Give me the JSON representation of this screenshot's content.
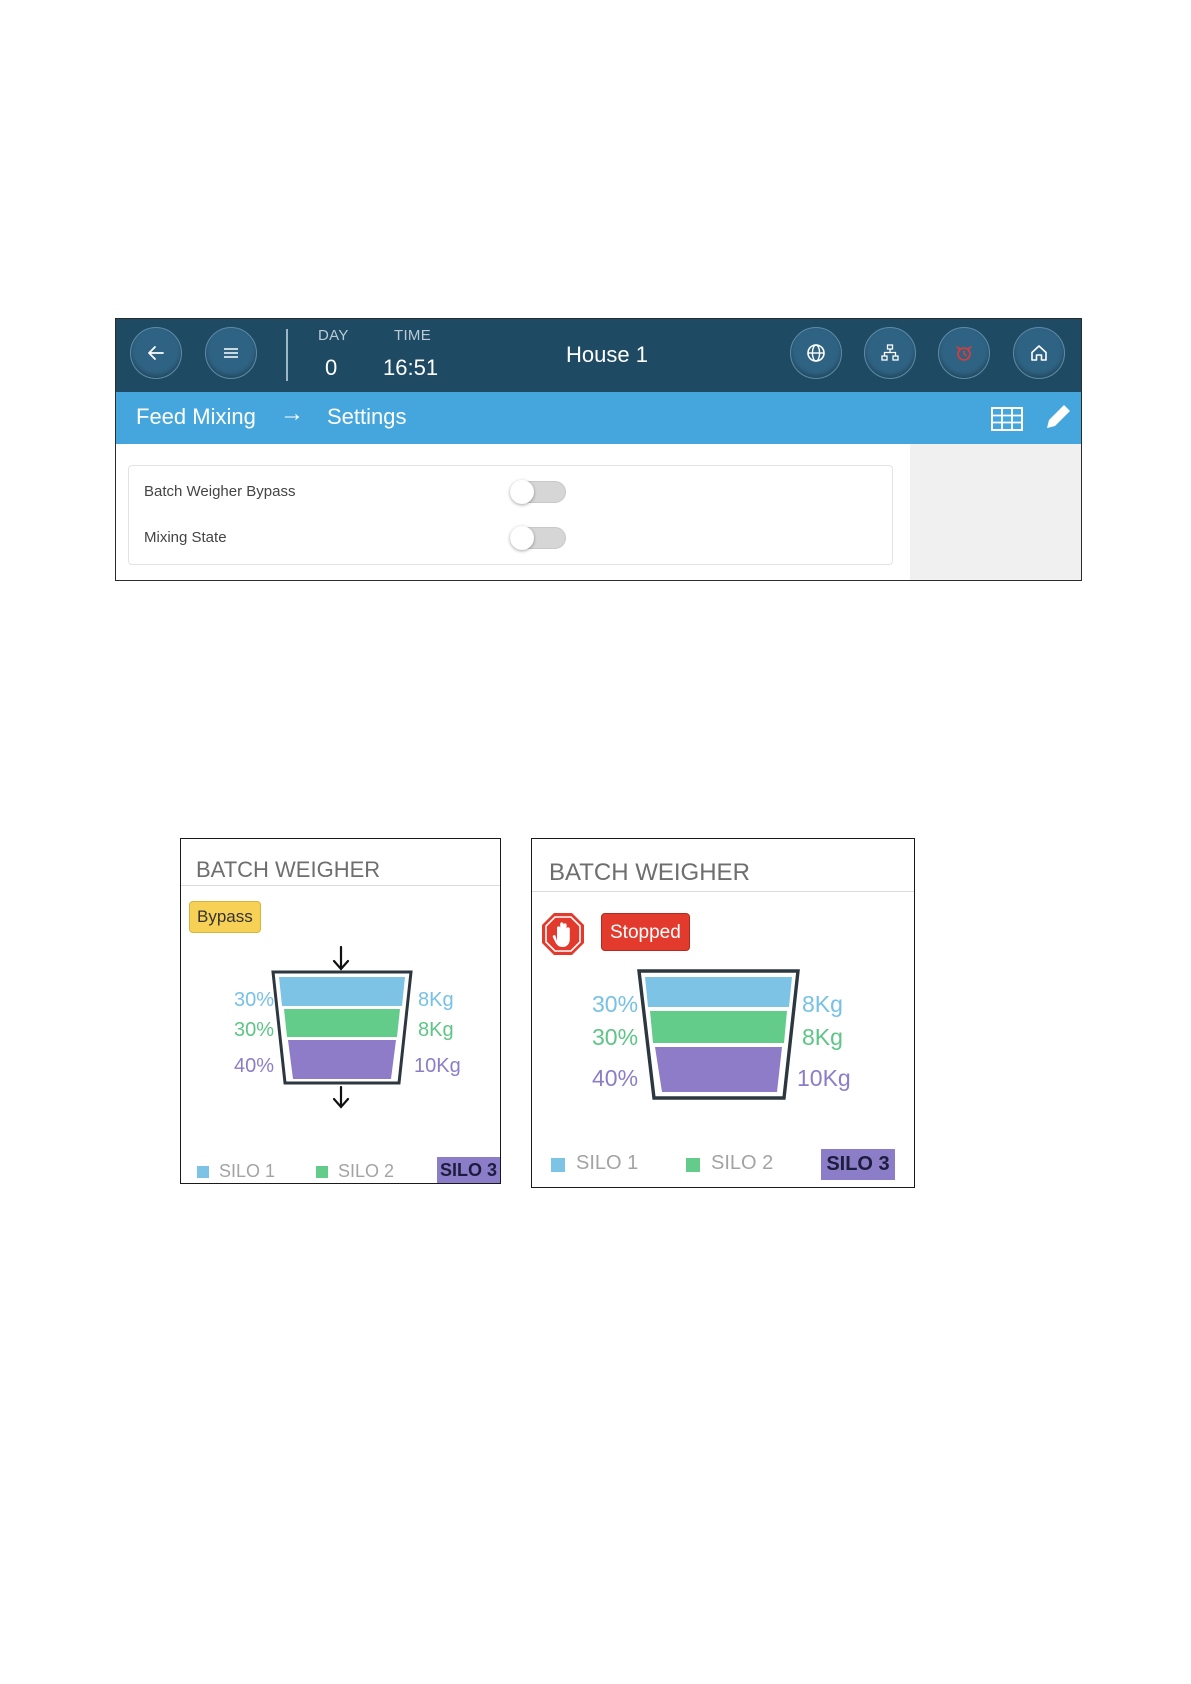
{
  "header": {
    "day_label": "DAY",
    "day_value": "0",
    "time_label": "TIME",
    "time_value": "16:51",
    "house_title": "House 1",
    "buttons": [
      "back-arrow-icon",
      "menu-icon",
      "globe-icon",
      "network-icon",
      "alarm-icon",
      "home-icon"
    ],
    "alarm_color": "#e53935"
  },
  "breadcrumb": {
    "section": "Feed Mixing",
    "separator_icon": "arrow-right-icon",
    "page": "Settings",
    "tools": [
      "table-icon",
      "edit-pencil-icon"
    ]
  },
  "settings": {
    "rows": [
      {
        "label": "Batch Weigher Bypass",
        "enabled": false
      },
      {
        "label": "Mixing State",
        "enabled": false
      }
    ]
  },
  "colors": {
    "topbar": "#1f4a63",
    "subbar": "#44a6dd",
    "silo1": "#7cc3e6",
    "silo2": "#64cc8a",
    "silo3": "#8e7cc8",
    "bypass_badge": "#f6d155",
    "stopped_badge": "#e23b2e"
  },
  "batch_weighers": [
    {
      "title": "BATCH WEIGHER",
      "status": "Bypass",
      "status_icon": "",
      "layers": [
        {
          "silo": "SILO 1",
          "percent": "30%",
          "weight": "8Kg"
        },
        {
          "silo": "SILO 2",
          "percent": "30%",
          "weight": "8Kg"
        },
        {
          "silo": "SILO 3",
          "percent": "40%",
          "weight": "10Kg"
        }
      ],
      "legend": [
        "SILO 1",
        "SILO 2",
        "SILO 3"
      ],
      "active_silo": "SILO 3"
    },
    {
      "title": "BATCH WEIGHER",
      "status": "Stopped",
      "status_icon": "stop-hand-icon",
      "layers": [
        {
          "silo": "SILO 1",
          "percent": "30%",
          "weight": "8Kg"
        },
        {
          "silo": "SILO 2",
          "percent": "30%",
          "weight": "8Kg"
        },
        {
          "silo": "SILO 3",
          "percent": "40%",
          "weight": "10Kg"
        }
      ],
      "legend": [
        "SILO 1",
        "SILO 2",
        "SILO 3"
      ],
      "active_silo": "SILO 3"
    }
  ]
}
